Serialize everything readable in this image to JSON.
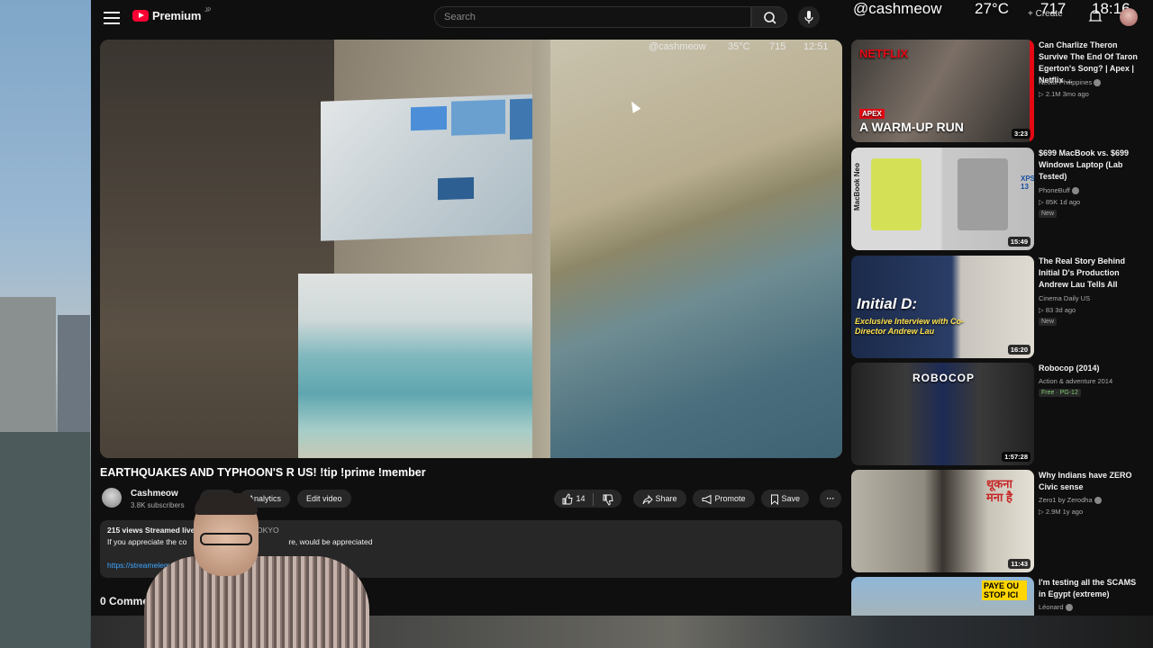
{
  "header": {
    "logo_text": "Premium",
    "logo_region": "JP",
    "search_placeholder": "Search",
    "create_label": "Create"
  },
  "hud": {
    "handle": "@cashmeow",
    "temperature": "27°C",
    "count": "717",
    "time": "18:16"
  },
  "video_overlay": {
    "handle": "@cashmeow",
    "temperature": "35°C",
    "count": "715",
    "time": "12:51"
  },
  "video": {
    "title": "EARTHQUAKES AND TYPHOON'S R US! !tip !prime !member",
    "channel": "Cashmeow",
    "subscribers": "3.8K subscribers",
    "analytics_label": "Analytics",
    "edit_label": "Edit video",
    "likes": "14",
    "share_label": "Share",
    "promote_label": "Promote",
    "save_label": "Save",
    "views_line": "215 views  Streamed live",
    "location_frag": "OKYO",
    "desc_text": "If you appreciate the co",
    "desc_text_end": "re, would be appreciated",
    "desc_link": "https://streamelements.co",
    "comments_label": "0 Comment"
  },
  "sidebar": {
    "items": [
      {
        "title": "Can Charlize Theron Survive The End Of Taron Egerton's Song? | Apex | Netflix ...",
        "channel": "Netflix Philippines",
        "stats": "2.1M  3mo ago",
        "duration": "3:23",
        "badge": "",
        "thumb_text": "A WARM-UP RUN",
        "thumb_brand": "NETFLIX",
        "thumb_tag": "APEX"
      },
      {
        "title": "$699 MacBook vs. $699 Windows Laptop (Lab Tested)",
        "channel": "PhoneBuff",
        "stats": "85K  1d ago",
        "duration": "15:49",
        "badge": "New",
        "thumb_text": "MacBook Neo",
        "thumb_brand": "XPS 13",
        "thumb_tag": ""
      },
      {
        "title": "The Real Story Behind Initial D's Production Andrew Lau Tells All",
        "channel": "Cinema Daily US",
        "stats": "83  3d ago",
        "duration": "16:20",
        "badge": "New",
        "thumb_text": "Initial D:",
        "thumb_brand": "Exclusive Interview with Co-Director Andrew Lau",
        "thumb_tag": ""
      },
      {
        "title": "Robocop (2014)",
        "channel": "Action & adventure 2014",
        "stats": "",
        "duration": "1:57:28",
        "badge": "Free · PG-12",
        "thumb_text": "ROBOCOP",
        "thumb_brand": "",
        "thumb_tag": ""
      },
      {
        "title": "Why Indians have ZERO Civic sense",
        "channel": "Zero1 by Zerodha",
        "stats": "2.9M  1y ago",
        "duration": "11:43",
        "badge": "",
        "thumb_text": "थूकना मना है",
        "thumb_brand": "",
        "thumb_tag": ""
      },
      {
        "title": "I'm testing all the SCAMS in Egypt (extreme)",
        "channel": "Léonard",
        "stats": "",
        "duration": "",
        "badge": "",
        "thumb_text": "PAYE OU STOP ICI",
        "thumb_brand": "",
        "thumb_tag": ""
      }
    ]
  },
  "colors": {
    "brand_red": "#ff0033",
    "link_blue": "#3ea6ff",
    "bg": "#0f0f0f",
    "pill_bg": "#272727"
  }
}
